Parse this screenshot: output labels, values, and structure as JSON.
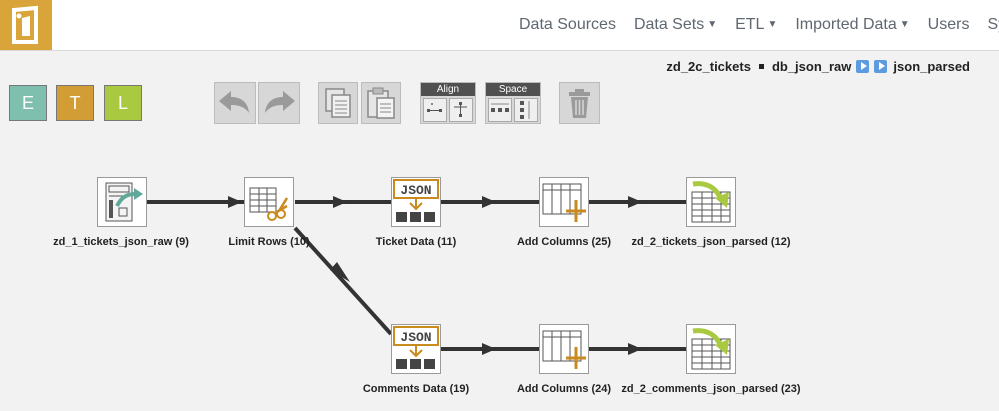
{
  "nav": {
    "items": [
      {
        "label": "Data Sources",
        "caret": false
      },
      {
        "label": "Data Sets",
        "caret": true
      },
      {
        "label": "ETL",
        "caret": true
      },
      {
        "label": "Imported Data",
        "caret": true
      },
      {
        "label": "Users",
        "caret": false
      },
      {
        "label": "System",
        "caret": false
      }
    ]
  },
  "breadcrumb": {
    "part1": "zd_2c_tickets",
    "part2": "db_json_raw",
    "part3": "json_parsed"
  },
  "toolbar": {
    "e_label": "E",
    "t_label": "T",
    "l_label": "L",
    "align_label": "Align",
    "space_label": "Space"
  },
  "nodes": [
    {
      "label": "zd_1_tickets_json_raw (9)",
      "icon": "database-source-icon"
    },
    {
      "label": "Limit Rows (10)",
      "icon": "scissors-table-icon"
    },
    {
      "label": "Ticket Data (11)",
      "icon": "json-icon"
    },
    {
      "label": "Add Columns (25)",
      "icon": "add-column-icon"
    },
    {
      "label": "zd_2_tickets_json_parsed (12)",
      "icon": "table-target-icon"
    },
    {
      "label": "Comments Data (19)",
      "icon": "json-icon"
    },
    {
      "label": "Add Columns (24)",
      "icon": "add-column-icon"
    },
    {
      "label": "zd_2_comments_json_parsed (23)",
      "icon": "table-target-icon"
    }
  ],
  "colors": {
    "brand": "#d9a53a",
    "e": "#7fbfae",
    "t": "#d39d36",
    "l": "#a9c940",
    "connector": "#333333"
  }
}
